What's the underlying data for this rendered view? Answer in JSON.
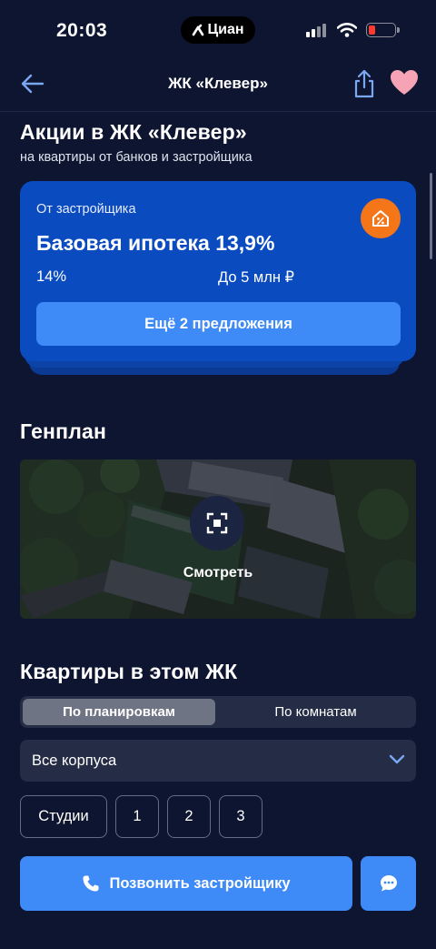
{
  "status_bar": {
    "time": "20:03",
    "app_pill": "Циан",
    "battery_color": "#ff3b30"
  },
  "nav": {
    "title": "ЖК «Клевер»",
    "back_icon": "arrow-left-icon",
    "share_icon": "share-icon",
    "favorite_icon": "heart-icon",
    "favorite_color": "#f5a3b5"
  },
  "promotions": {
    "title": "Акции в ЖК «Клевер»",
    "subtitle": "на квартиры от банков и застройщика",
    "card": {
      "label": "От застройщика",
      "heading": "Базовая ипотека 13,9%",
      "rate": "14%",
      "amount": "До 5 млн ₽",
      "badge_icon": "house-percent-icon",
      "badge_color": "#f47618",
      "more_button": "Ещё 2 предложения"
    }
  },
  "genplan": {
    "title": "Генплан",
    "view_icon": "fullscreen-icon",
    "view_label": "Смотреть"
  },
  "apartments": {
    "title": "Квартиры в этом ЖК",
    "tabs": [
      {
        "label": "По планировкам",
        "active": true
      },
      {
        "label": "По комнатам",
        "active": false
      }
    ],
    "building_select": "Все корпуса",
    "room_filters": [
      "Студии",
      "1",
      "2",
      "3"
    ]
  },
  "actions": {
    "call_button": "Позвонить застройщику",
    "call_icon": "phone-icon",
    "chat_icon": "chat-bubble-icon",
    "accent_color": "#3e8af7"
  }
}
